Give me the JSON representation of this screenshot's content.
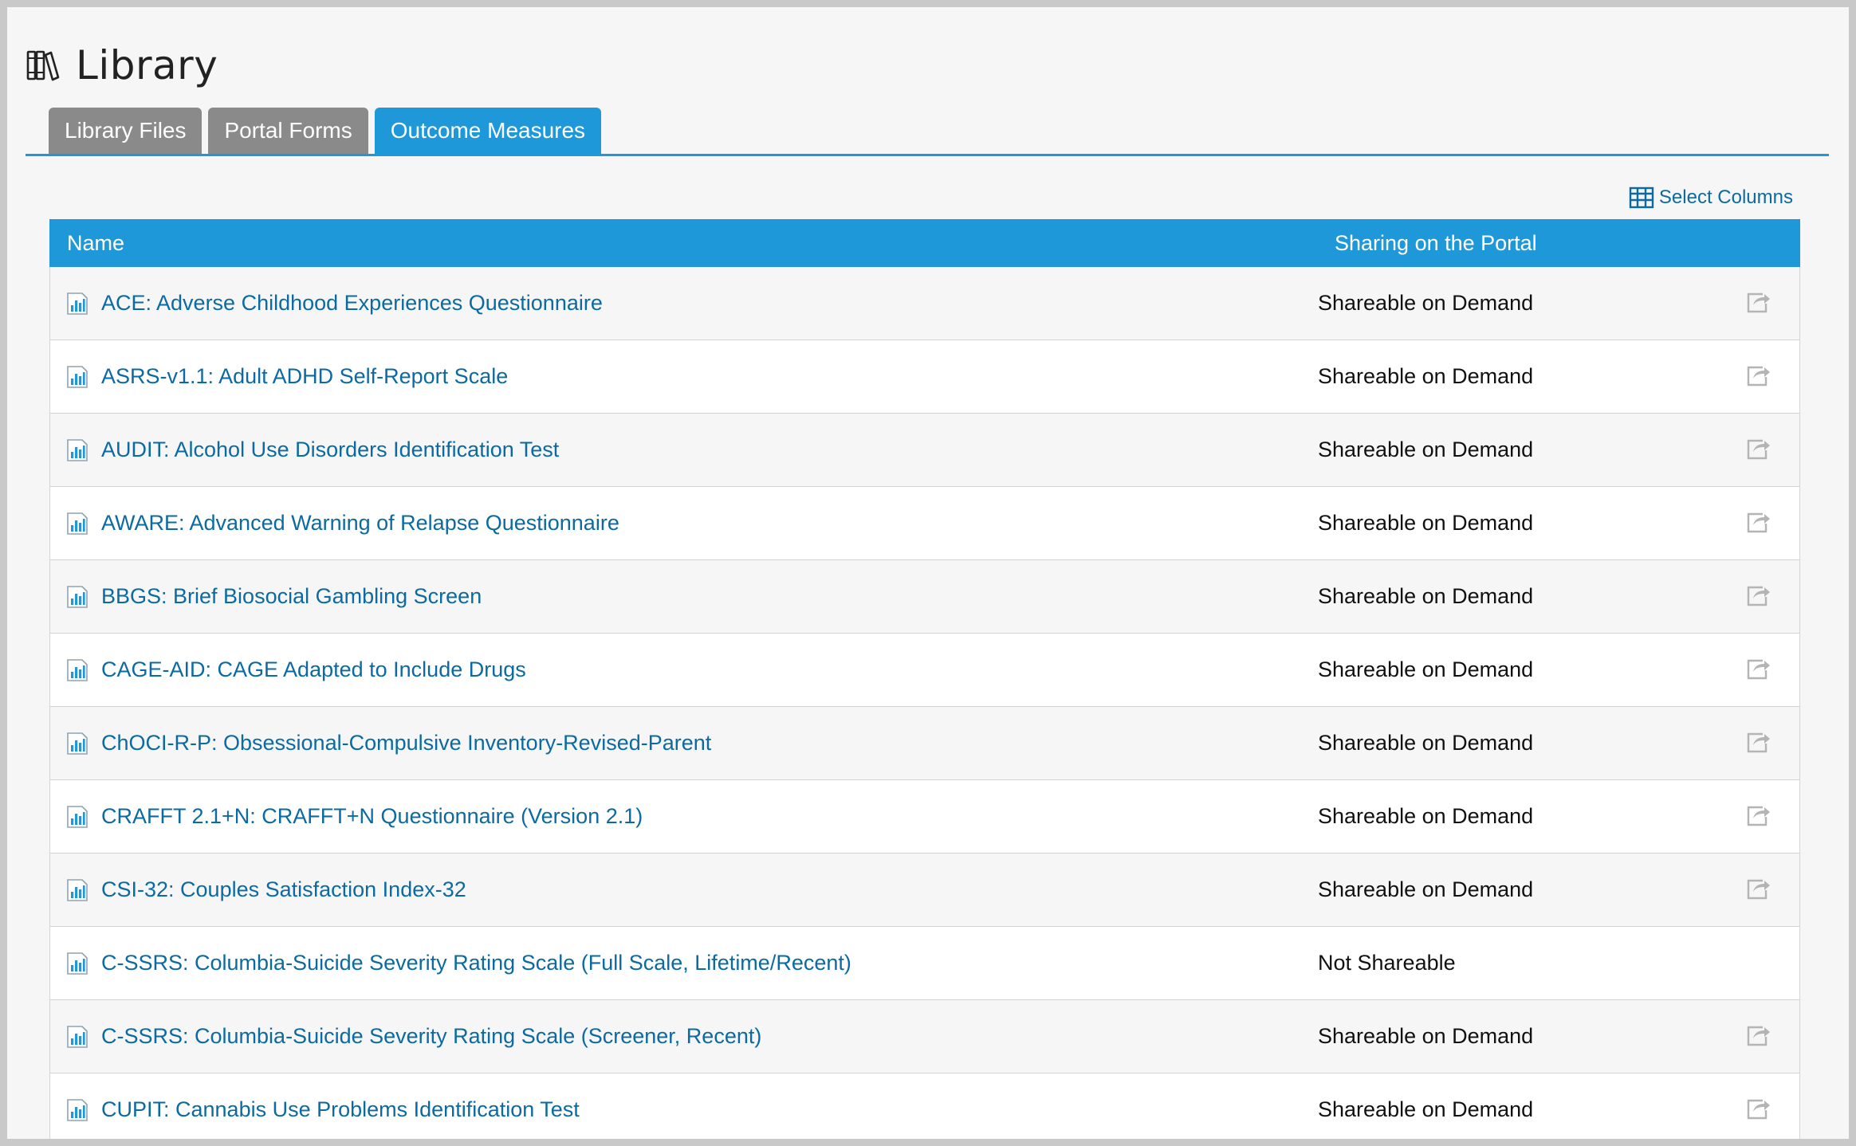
{
  "page": {
    "title": "Library",
    "title_icon": "books-icon"
  },
  "tabs": [
    {
      "label": "Library Files",
      "active": false
    },
    {
      "label": "Portal Forms",
      "active": false
    },
    {
      "label": "Outcome Measures",
      "active": true
    }
  ],
  "toolbar": {
    "select_columns_label": "Select Columns",
    "select_columns_icon": "table-grid-icon"
  },
  "table": {
    "columns": [
      "Name",
      "Sharing on the Portal"
    ],
    "rows": [
      {
        "name": "ACE: Adverse Childhood Experiences Questionnaire",
        "sharing": "Shareable on Demand",
        "shareable": true
      },
      {
        "name": "ASRS-v1.1: Adult ADHD Self-Report Scale",
        "sharing": "Shareable on Demand",
        "shareable": true
      },
      {
        "name": "AUDIT: Alcohol Use Disorders Identification Test",
        "sharing": "Shareable on Demand",
        "shareable": true
      },
      {
        "name": "AWARE: Advanced Warning of Relapse Questionnaire",
        "sharing": "Shareable on Demand",
        "shareable": true
      },
      {
        "name": "BBGS: Brief Biosocial Gambling Screen",
        "sharing": "Shareable on Demand",
        "shareable": true
      },
      {
        "name": "CAGE-AID: CAGE Adapted to Include Drugs",
        "sharing": "Shareable on Demand",
        "shareable": true
      },
      {
        "name": "ChOCI-R-P: Obsessional-Compulsive Inventory-Revised-Parent",
        "sharing": "Shareable on Demand",
        "shareable": true
      },
      {
        "name": "CRAFFT 2.1+N: CRAFFT+N Questionnaire (Version 2.1)",
        "sharing": "Shareable on Demand",
        "shareable": true
      },
      {
        "name": "CSI-32: Couples Satisfaction Index-32",
        "sharing": "Shareable on Demand",
        "shareable": true
      },
      {
        "name": "C-SSRS: Columbia-Suicide Severity Rating Scale (Full Scale, Lifetime/Recent)",
        "sharing": "Not Shareable",
        "shareable": false
      },
      {
        "name": "C-SSRS: Columbia-Suicide Severity Rating Scale (Screener, Recent)",
        "sharing": "Shareable on Demand",
        "shareable": true
      },
      {
        "name": "CUPIT: Cannabis Use Problems Identification Test",
        "sharing": "Shareable on Demand",
        "shareable": true
      }
    ]
  },
  "colors": {
    "accent": "#1e98d8",
    "link": "#0b6aa2",
    "tab_inactive": "#8a8a8a",
    "icon_gray": "#b4b4b4"
  }
}
